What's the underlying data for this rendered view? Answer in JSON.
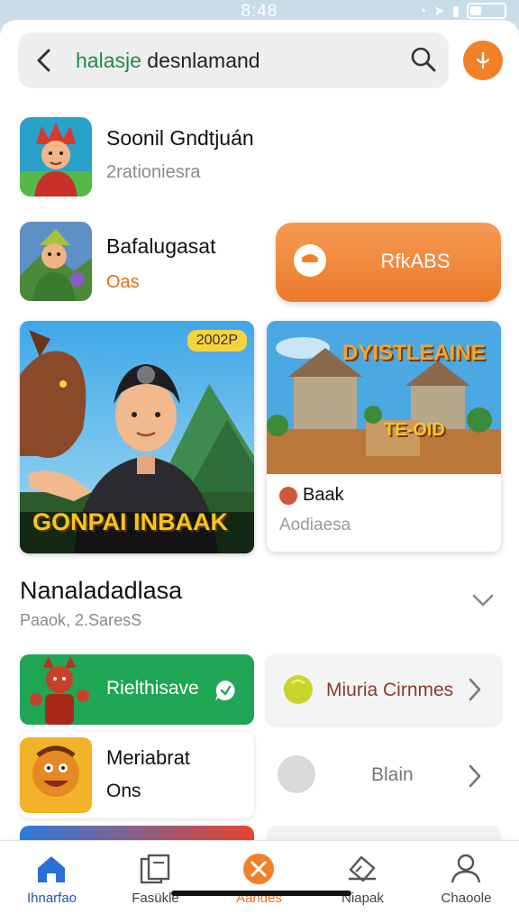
{
  "status_bar": {
    "time": "8:48"
  },
  "search": {
    "prefix": "halasje",
    "text": "desnlamand"
  },
  "apps": [
    {
      "title": "Soonil Gndtjuán",
      "subtitle": "2rationiesra"
    },
    {
      "title": "Bafalugasat",
      "subtitle": "Oas"
    }
  ],
  "cta": {
    "label": "RfkABS"
  },
  "hero_card": {
    "badge": "2002P",
    "title": "GONPAI INBAAK"
  },
  "game_card": {
    "heading": "DYISTLEAINE",
    "banner": "TE-OID",
    "title": "Baak",
    "subtitle": "Aodiaesa"
  },
  "section": {
    "title": "Nanaladadlasa",
    "subtitle": "Paaok, 2.SaresS"
  },
  "tiles": {
    "green": {
      "label": "Rielthisave"
    },
    "miuria": {
      "label": "Miuria Cirnmes"
    },
    "white": {
      "title": "Meriabrat",
      "subtitle": "Ons"
    },
    "blain": {
      "label": "Blain"
    }
  },
  "bottom_nav": [
    {
      "label": "Ihnarfao",
      "icon": "home-icon",
      "state": "active"
    },
    {
      "label": "Fasükle",
      "icon": "library-icon",
      "state": ""
    },
    {
      "label": "Aandes",
      "icon": "close-icon",
      "state": "orange"
    },
    {
      "label": "Niapak",
      "icon": "ticket-icon",
      "state": ""
    },
    {
      "label": "Chaoole",
      "icon": "person-icon",
      "state": ""
    }
  ],
  "colors": {
    "accent": "#f08128",
    "green": "#1fa655",
    "nav_active": "#1f56b8"
  }
}
